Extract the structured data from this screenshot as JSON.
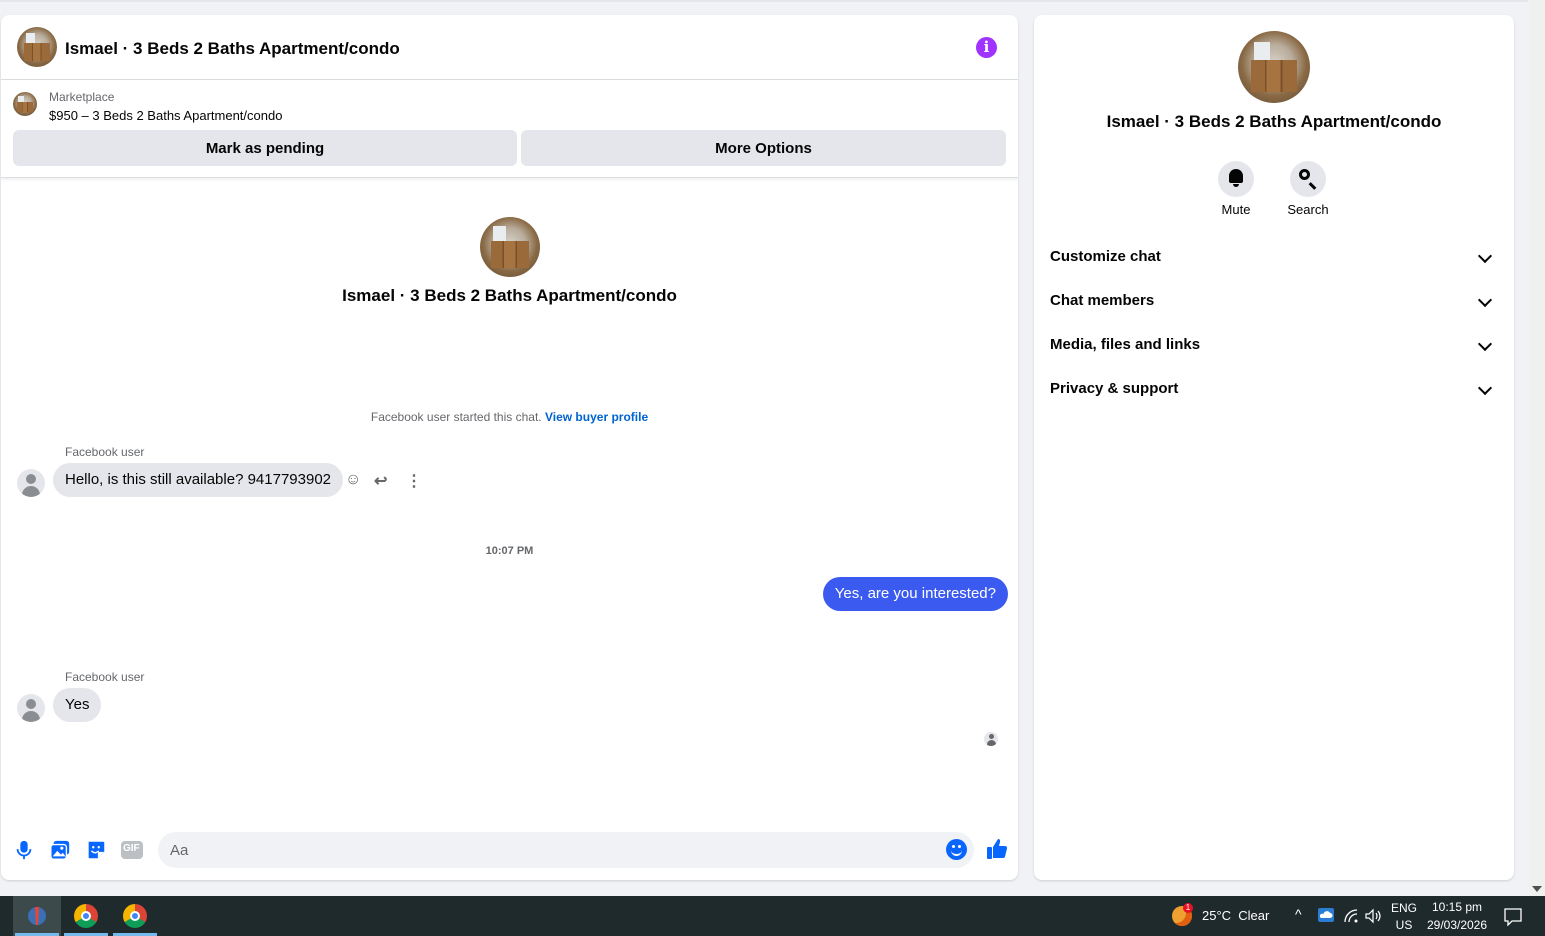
{
  "chat": {
    "title": "Ismael · 3 Beds 2 Baths Apartment/condo",
    "info_icon": "i",
    "listing": {
      "source": "Marketplace",
      "price_line": "$950 – 3 Beds 2 Baths Apartment/condo",
      "mark_pending_label": "Mark as pending",
      "more_options_label": "More Options"
    },
    "intro_title": "Ismael · 3 Beds 2 Baths Apartment/condo",
    "started_text": "Facebook user started this chat.",
    "view_buyer_link": "View buyer profile",
    "messages": [
      {
        "sender": "Facebook user",
        "text": "Hello, is this still available? 9417793902",
        "direction": "in"
      },
      {
        "timestamp": "10:07 PM"
      },
      {
        "text": "Yes, are you interested?",
        "direction": "out"
      },
      {
        "sender": "Facebook user",
        "text": "Yes",
        "direction": "in"
      }
    ],
    "message_actions": {
      "react": "☺",
      "reply": "↩",
      "more": "⋮"
    },
    "composer": {
      "placeholder": "Aa",
      "icons": [
        "microphone-icon",
        "photo-icon",
        "sticker-icon",
        "gif-icon"
      ],
      "gif_label": "GIF",
      "like_icon": "👍"
    }
  },
  "side": {
    "title": "Ismael · 3 Beds 2 Baths Apartment/condo",
    "mute_label": "Mute",
    "search_label": "Search",
    "menu": [
      {
        "label": "Customize chat"
      },
      {
        "label": "Chat members"
      },
      {
        "label": "Media, files and links"
      },
      {
        "label": "Privacy & support"
      }
    ]
  },
  "taskbar": {
    "weather": "25°C  Clear",
    "weather_badge": "1",
    "lang_top": "ENG",
    "lang_bottom": "US",
    "time": "10:15 pm",
    "date": "29/03/2026",
    "tray_up": "^"
  }
}
